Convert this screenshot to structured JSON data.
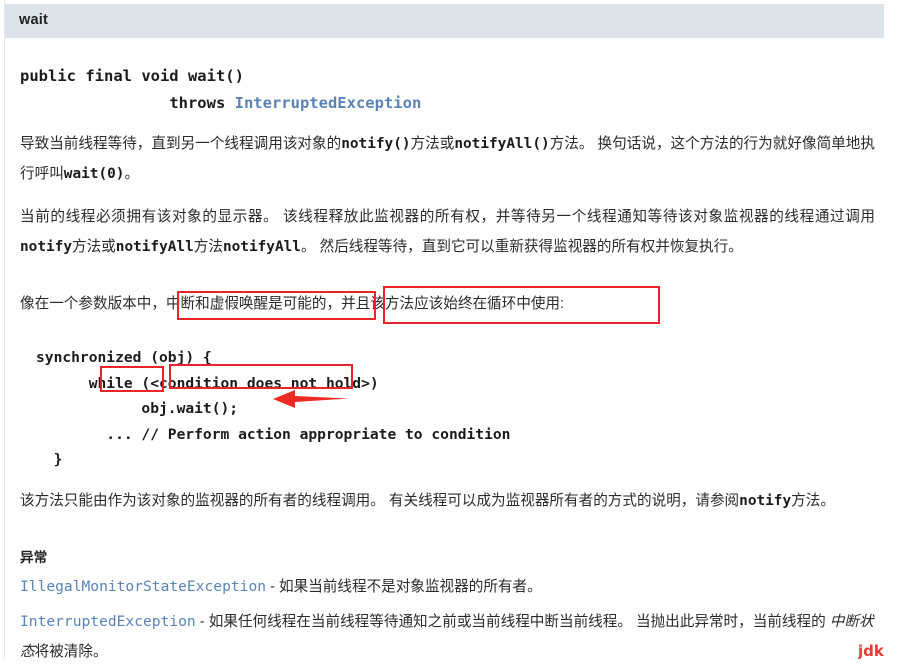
{
  "member": {
    "name": "wait",
    "signature_line1": "public final void wait()",
    "signature_indent2": "                ",
    "signature_throws_keyword": "throws ",
    "signature_throws_type": "InterruptedException"
  },
  "paragraphs": {
    "p1_a": "导致当前线程等待，直到另一个线程调用该对象的",
    "p1_code1": "notify()",
    "p1_b": "方法或",
    "p1_code2": "notifyAll()",
    "p1_c": "方法。 换句话说，这个方法的行为就好像简单地执行呼叫",
    "p1_code3": "wait(0)",
    "p1_d": "。",
    "p2_a": "当前的线程必须拥有该对象的显示器。 该线程释放此监视器的所有权，并等待另一个线程通知等待该对象监视器的线程通过调用",
    "p2_code1": "notify",
    "p2_b": "方法或",
    "p2_code2": "notifyAll",
    "p2_c": "方法",
    "p2_code3": "notifyAll",
    "p2_d": "。 然后线程等待，直到它可以重新获得监视器的所有权并恢复执行。",
    "p3_a": "像在一个参数版本中，",
    "p3_highlight1": "中断和虚假唤醒是可能的，",
    "p3_highlight2": "并且该方法应该始终在循环中使用:",
    "p4_a": "该方法只能由作为该对象的监视器的所有者的线程调用。 有关线程可以成为监视器所有者的方式的说明，请参阅",
    "p4_code1": "notify",
    "p4_b": "方法。"
  },
  "code_block": {
    "line1": "synchronized (obj) {",
    "line2": "      while (<condition does not hold>)",
    "line3": "            obj.wait();",
    "line4": "        ... // Perform action appropriate to condition",
    "line5": "  }"
  },
  "throws_section": {
    "heading": "异常",
    "items": [
      {
        "type": "IllegalMonitorStateException",
        "dash": " - ",
        "desc_a": "如果当前线程不是对象监视器的所有者。",
        "desc_em": "",
        "desc_b": ""
      },
      {
        "type": "InterruptedException",
        "dash": " - ",
        "desc_a": "如果任何线程在当前线程等待通知之前或当前线程中断当前线程。 当抛出此异常时，当前线程的 ",
        "desc_em": "中断状态",
        "desc_b": "将被清除。"
      }
    ]
  },
  "annotations": {
    "redbox_color": "#e8252a",
    "arrow_color": "#ee2b22",
    "arrow_direction": "left",
    "boxes": [
      "中断和虚假唤醒是可能的，",
      "并且该方法应该始终在循环中使用:",
      "while",
      "<condition does not"
    ]
  },
  "watermark": {
    "text": "jdk",
    "color": "#ea3b32"
  },
  "theme": {
    "header_bg": "#dee3e9",
    "link_color": "#5b83b5",
    "text_color": "#2b2b2b",
    "page_bg": "#ffffff"
  }
}
